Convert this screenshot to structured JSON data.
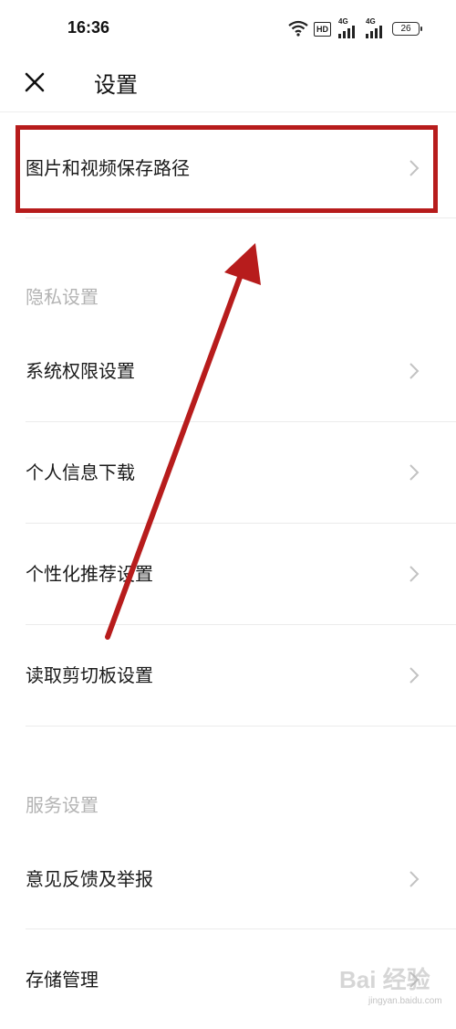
{
  "status_bar": {
    "time": "16:36",
    "hd_label": "HD",
    "signal_label_1": "4G",
    "signal_label_2": "4G",
    "battery": "26",
    "icons": [
      "wifi-icon",
      "hd-badge",
      "signal-icon",
      "signal-icon",
      "battery-icon"
    ]
  },
  "header": {
    "title": "设置",
    "close_icon": "close-icon"
  },
  "top_item": {
    "label": "图片和视频保存路径"
  },
  "privacy_section": {
    "title": "隐私设置",
    "items": [
      {
        "label": "系统权限设置"
      },
      {
        "label": "个人信息下载"
      },
      {
        "label": "个性化推荐设置"
      },
      {
        "label": "读取剪切板设置"
      }
    ]
  },
  "service_section": {
    "title": "服务设置",
    "items": [
      {
        "label": "意见反馈及举报"
      },
      {
        "label": "存储管理"
      }
    ]
  },
  "annotation": {
    "color": "#b71c1c"
  },
  "watermark": {
    "text": "Bai 经验",
    "sub": "jingyan.baidu.com"
  }
}
